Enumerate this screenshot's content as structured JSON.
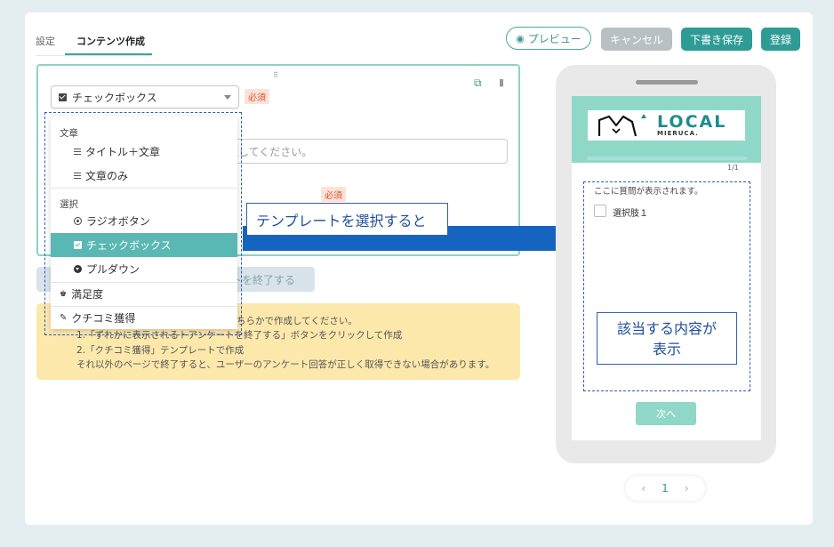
{
  "tabs": [
    {
      "label": "設定"
    },
    {
      "label": "コンテンツ作成",
      "active": true
    }
  ],
  "header": {
    "preview_label": "プレビュー",
    "cancel_label": "キャンセル",
    "draft_label": "下書き保存",
    "register_label": "登録"
  },
  "editor": {
    "grip": "⠿",
    "type_select_value": "チェックボックス",
    "required_label": "必須",
    "question_placeholder_visible": "択してください。",
    "required_label_2": "必須"
  },
  "dropdown": {
    "groups": [
      {
        "label": "文章",
        "items": [
          {
            "label": "タイトル＋文章",
            "icon": "title-text-icon"
          },
          {
            "label": "文章のみ",
            "icon": "text-only-icon"
          }
        ]
      },
      {
        "label": "選択",
        "items": [
          {
            "label": "ラジオボタン",
            "icon": "radio-icon"
          },
          {
            "label": "チェックボックス",
            "icon": "checkbox-icon",
            "selected": true
          },
          {
            "label": "プルダウン",
            "icon": "pulldown-icon"
          }
        ]
      }
    ],
    "satisfaction_label": "満足度",
    "review_label": "クチコミ獲得"
  },
  "end_button_label": "トを終了する",
  "notice": {
    "line1": "ちらかで作成してください。",
    "line2": "1.「ずれかに表示されるトアンケートを終了する」ボタンをクリックして作成",
    "line3": "2.「クチコミ獲得」テンプレートで作成",
    "line4": "それ以外のページで終了すると、ユーザーのアンケート回答が正しく取得できない場合があります。"
  },
  "annotations": {
    "template_callout": "テンプレートを選択すると",
    "display_callout_line1": "該当する内容が",
    "display_callout_line2": "表示"
  },
  "preview": {
    "logo_main": "LOCAL",
    "logo_sub": "MIERUCA.",
    "page_count": "1/1",
    "question_text": "ここに質問が表示されます。",
    "option_label": "選択肢１",
    "next_label": "次へ",
    "progress": 1.0
  },
  "pager": {
    "prev": "‹",
    "current": "1",
    "next": "›"
  },
  "colors": {
    "accent": "#2e9c95",
    "arrow": "#1565c0",
    "callout_border": "#2f5fb0",
    "notice_bg": "#fde8ac"
  }
}
